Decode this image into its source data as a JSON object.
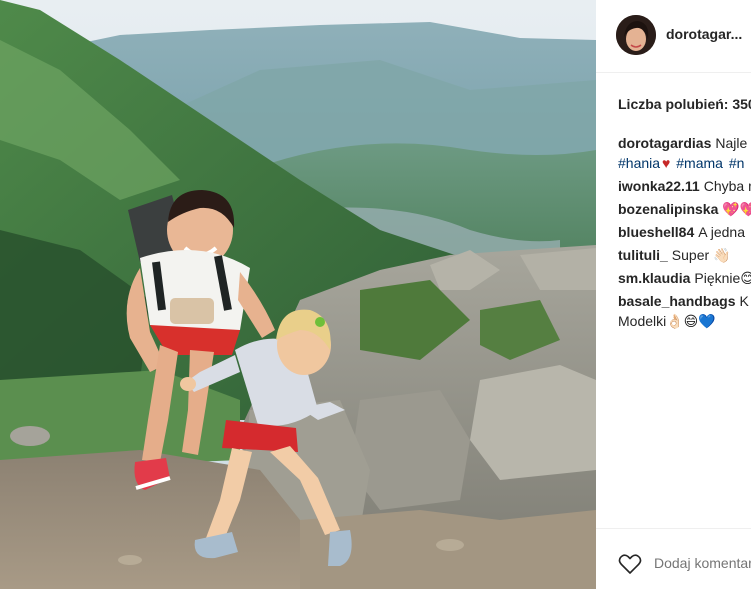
{
  "post": {
    "username": "dorotagar...",
    "likes_label": "Liczba polubień: 350",
    "caption": {
      "author": "dorotagardias",
      "text": "Najle",
      "hashtags": [
        "#hania",
        "#mama",
        "#n"
      ]
    },
    "comments": [
      {
        "author": "iwonka22.11",
        "text": "Chyba n"
      },
      {
        "author": "bozenalipinska",
        "text": "💖💖"
      },
      {
        "author": "blueshell84",
        "text": "A jedna"
      },
      {
        "author": "tulituli_",
        "text": "Super 👋🏻"
      },
      {
        "author": "sm.klaudia",
        "text": "Pięknie😊"
      },
      {
        "author": "basale_handbags",
        "text": "K"
      },
      {
        "author": "",
        "text": "Modelki👌🏻😄💙"
      }
    ],
    "add_comment_placeholder": "Dodaj komentarz..."
  },
  "icons": {
    "like": "heart-outline-icon",
    "hashtag_heart": "red-heart-icon"
  },
  "colors": {
    "hashtag": "#003569",
    "text": "#262626",
    "muted": "#999999",
    "divider": "#efefef"
  }
}
